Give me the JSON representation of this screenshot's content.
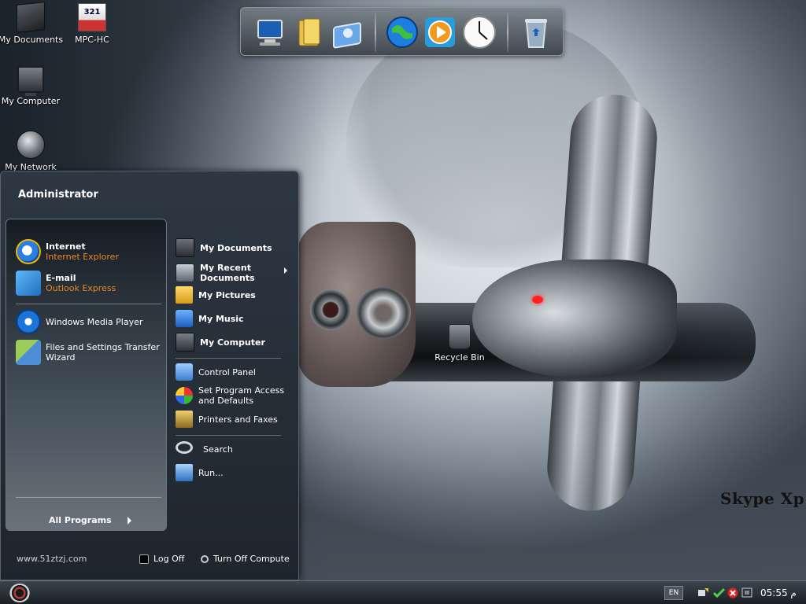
{
  "desktop": {
    "icons": [
      {
        "label": "My Documents"
      },
      {
        "label": "MPC-HC"
      },
      {
        "label": "My Computer"
      },
      {
        "label": "My Network"
      },
      {
        "label": "Recycle Bin"
      }
    ],
    "mpc_badge": "321",
    "watermark": "Skype Xp"
  },
  "dock": {
    "items": [
      "monitor-icon",
      "folder-icon",
      "network-folder-icon",
      "globe-icon",
      "media-player-icon",
      "clock-icon",
      "recycle-bin-icon"
    ]
  },
  "start_menu": {
    "user": "Administrator",
    "pinned": [
      {
        "title": "Internet",
        "subtitle": "Internet Explorer",
        "icon": "ie-icon"
      },
      {
        "title": "E-mail",
        "subtitle": "Outlook Express",
        "icon": "mail-icon"
      }
    ],
    "recent": [
      {
        "label": "Windows Media Player",
        "icon": "wmp-icon"
      },
      {
        "label_line1": "Files and Settings Transfer",
        "label_line2": "Wizard",
        "icon": "transfer-icon"
      }
    ],
    "all_programs": "All Programs",
    "right": {
      "places": [
        {
          "label": "My Documents"
        },
        {
          "label_line1": "My Recent",
          "label_line2": "Documents"
        },
        {
          "label": "My Pictures"
        },
        {
          "label": "My Music"
        },
        {
          "label": "My Computer"
        }
      ],
      "settings": [
        {
          "label": "Control Panel"
        },
        {
          "label_line1": "Set Program Access",
          "label_line2": "and Defaults"
        },
        {
          "label": "Printers and Faxes"
        }
      ],
      "tools": [
        {
          "label": "Search"
        },
        {
          "label": "Run..."
        }
      ]
    },
    "footer": {
      "site": "www.51ztzj.com",
      "log_off": "Log Off",
      "turn_off": "Turn Off Compute"
    }
  },
  "taskbar": {
    "language": "EN",
    "time": "05:55 م"
  },
  "colors": {
    "accent_orange": "#e8882a",
    "menu_bg": "#1e252d"
  }
}
